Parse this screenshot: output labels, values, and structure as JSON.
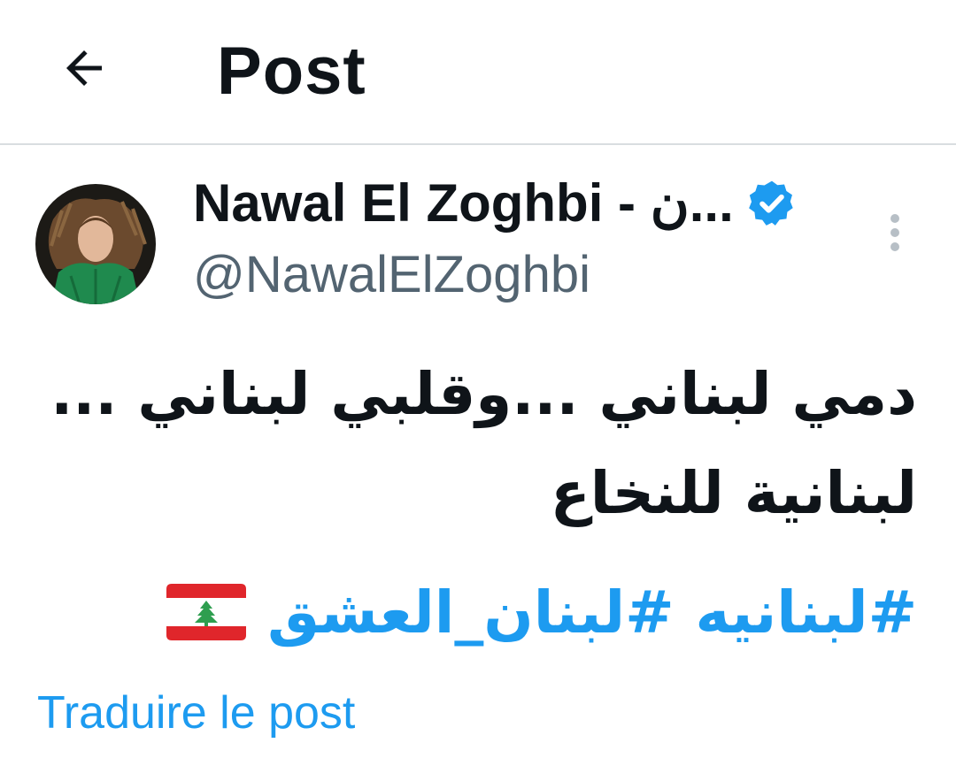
{
  "header": {
    "title": "Post",
    "back_icon": "arrow-left-icon"
  },
  "post": {
    "author": {
      "name": "Nawal El Zoghbi - ن...",
      "handle": "@NawalElZoghbi",
      "verified": true
    },
    "text_lines": [
      "دمي لبناني ...وقلبي لبناني ...",
      "لبنانية للنخاع"
    ],
    "hashtags": [
      "#لبنانيه",
      "#لبنان_العشق"
    ],
    "flag_emoji": "lebanon-flag",
    "translate_label": "Traduire le post"
  },
  "colors": {
    "accent": "#1d9bf0",
    "secondary_text": "#536471",
    "text": "#0f1419",
    "divider": "#d9dde0"
  }
}
